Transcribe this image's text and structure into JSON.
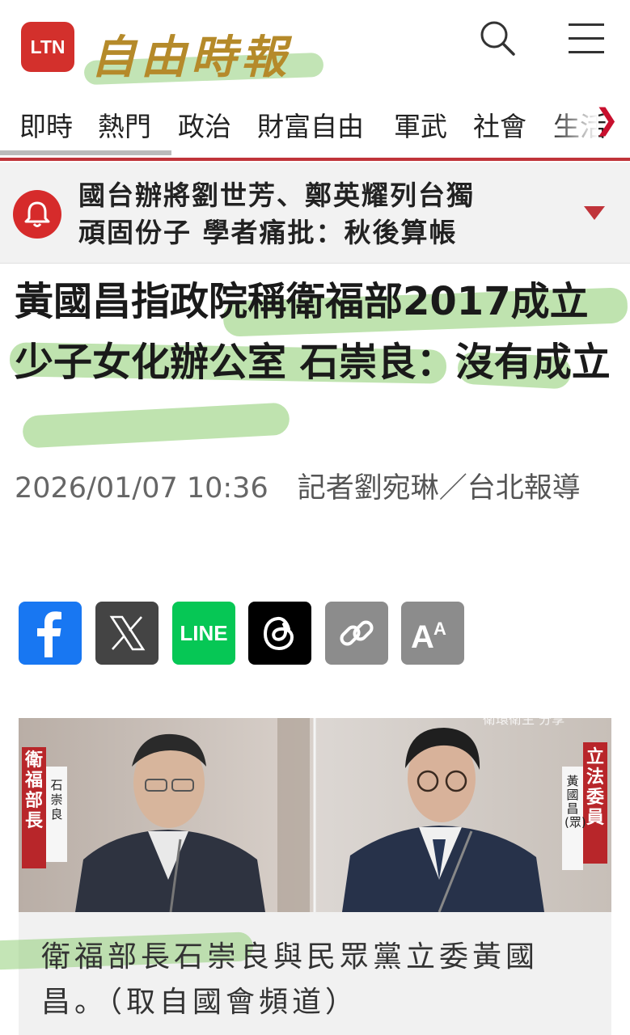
{
  "header": {
    "logo_text": "LTN",
    "brand": "自由時報",
    "search_icon": "search-icon",
    "menu_icon": "hamburger-menu-icon"
  },
  "nav": {
    "items": [
      "即時",
      "熱門",
      "政治",
      "財富自由",
      "軍武",
      "社會",
      "生活"
    ],
    "more_icon": "chevron-right-icon"
  },
  "alert": {
    "icon": "bell-icon",
    "text_line1": "國台辦將劉世芳、鄭英耀列台獨",
    "text_line2": "頑固份子 學者痛批：秋後算帳",
    "expand_icon": "caret-down-icon"
  },
  "article": {
    "title": "黃國昌指政院稱衛福部2017成立少子女化辦公室 石崇良：沒有成立",
    "date": "2026/01/07 10:36",
    "byline": "記者劉宛琳／台北報導"
  },
  "share": {
    "buttons": [
      {
        "name": "facebook",
        "label": "f",
        "color": "#1877f2"
      },
      {
        "name": "x",
        "label": "𝕏",
        "color": "#444444"
      },
      {
        "name": "line",
        "label": "LINE",
        "color": "#06c755"
      },
      {
        "name": "threads",
        "label": "@",
        "color": "#000000"
      },
      {
        "name": "copy-link",
        "label": "",
        "color": "#8c8c8c"
      },
      {
        "name": "font-size",
        "label": "AA",
        "color": "#8c8c8c"
      }
    ]
  },
  "photo": {
    "left_title": "衛福部長",
    "left_name": "石崇良",
    "right_title": "立法委員",
    "right_name": "黃國昌(眾)",
    "top_text": "衛環衛生 分享"
  },
  "caption": {
    "text": "衛福部長石崇良與民眾黨立委黃國昌。（取自國會頻道）"
  },
  "colors": {
    "brand_red": "#c0343a",
    "highlight_green": "#8acc6e",
    "brand_gold": "#b58a2a"
  }
}
